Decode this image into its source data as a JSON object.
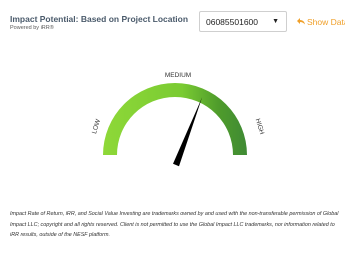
{
  "header": {
    "title": "Impact Potential: Based on Project Location",
    "subtitle": "Powered by iRR®"
  },
  "location_select": {
    "value": "06085501600",
    "caret_icon": "caret-down-icon"
  },
  "show_data": {
    "label": "Show Data",
    "icon": "reply-arrow-icon",
    "color": "#f0a02a"
  },
  "gauge": {
    "labels": {
      "low": "LOW",
      "medium": "MEDIUM",
      "high": "HIGH"
    },
    "value_fraction": 0.64,
    "colors": {
      "low": "#8ed838",
      "mid_light": "#7acb32",
      "mid_dark": "#4f9c2b",
      "high": "#3f8a34",
      "needle": "#000000"
    }
  },
  "footer": {
    "disclaimer": "Impact Rate of Return, iRR, and Social Value Investing are trademarks owned by and used with the non-transferable permission of Global Impact LLC; copyright and all rights reserved. Client is not permitted to use the Global Impact LLC trademarks, nor information related to iRR results, outside of the NESF platform."
  }
}
